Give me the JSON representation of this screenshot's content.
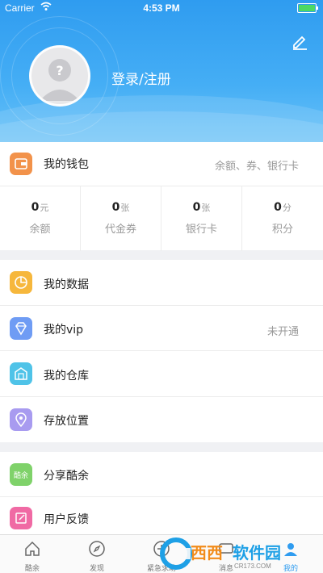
{
  "status_bar": {
    "carrier": "Carrier",
    "time": "4:53 PM"
  },
  "profile": {
    "login_text": "登录/注册",
    "edit_icon": "pencil-icon"
  },
  "wallet": {
    "label": "我的钱包",
    "detail": "余额、券、银行卡",
    "stats": [
      {
        "value": "0",
        "unit": "元",
        "caption": "余额"
      },
      {
        "value": "0",
        "unit": "张",
        "caption": "代金券"
      },
      {
        "value": "0",
        "unit": "张",
        "caption": "银行卡"
      },
      {
        "value": "0",
        "unit": "分",
        "caption": "积分"
      }
    ]
  },
  "menu_group_1": [
    {
      "label": "我的数据",
      "detail": "",
      "icon": "pie-chart-icon",
      "color": "#f6b73c"
    },
    {
      "label": "我的vip",
      "detail": "未开通",
      "icon": "diamond-icon",
      "color": "#6f9cf4"
    },
    {
      "label": "我的仓库",
      "detail": "",
      "icon": "warehouse-icon",
      "color": "#4fc3e8"
    },
    {
      "label": "存放位置",
      "detail": "",
      "icon": "location-pin-icon",
      "color": "#a89bf0"
    }
  ],
  "menu_group_2": [
    {
      "label": "分享酷余",
      "detail": "",
      "icon": "share-icon",
      "color": "#7fd26a"
    },
    {
      "label": "用户反馈",
      "detail": "",
      "icon": "feedback-icon",
      "color": "#f06aa4"
    }
  ],
  "wallet_icon_color": "#f2924a",
  "tabs": [
    {
      "label": "酷余",
      "icon": "home-icon"
    },
    {
      "label": "发现",
      "icon": "compass-icon"
    },
    {
      "label": "紧急求助",
      "icon": "help-icon"
    },
    {
      "label": "消息",
      "icon": "message-icon"
    },
    {
      "label": "我的",
      "icon": "user-icon"
    }
  ],
  "accent_color": "#2f9cf0",
  "watermark": {
    "brand": "西西软件园",
    "url": "CR173.COM"
  }
}
